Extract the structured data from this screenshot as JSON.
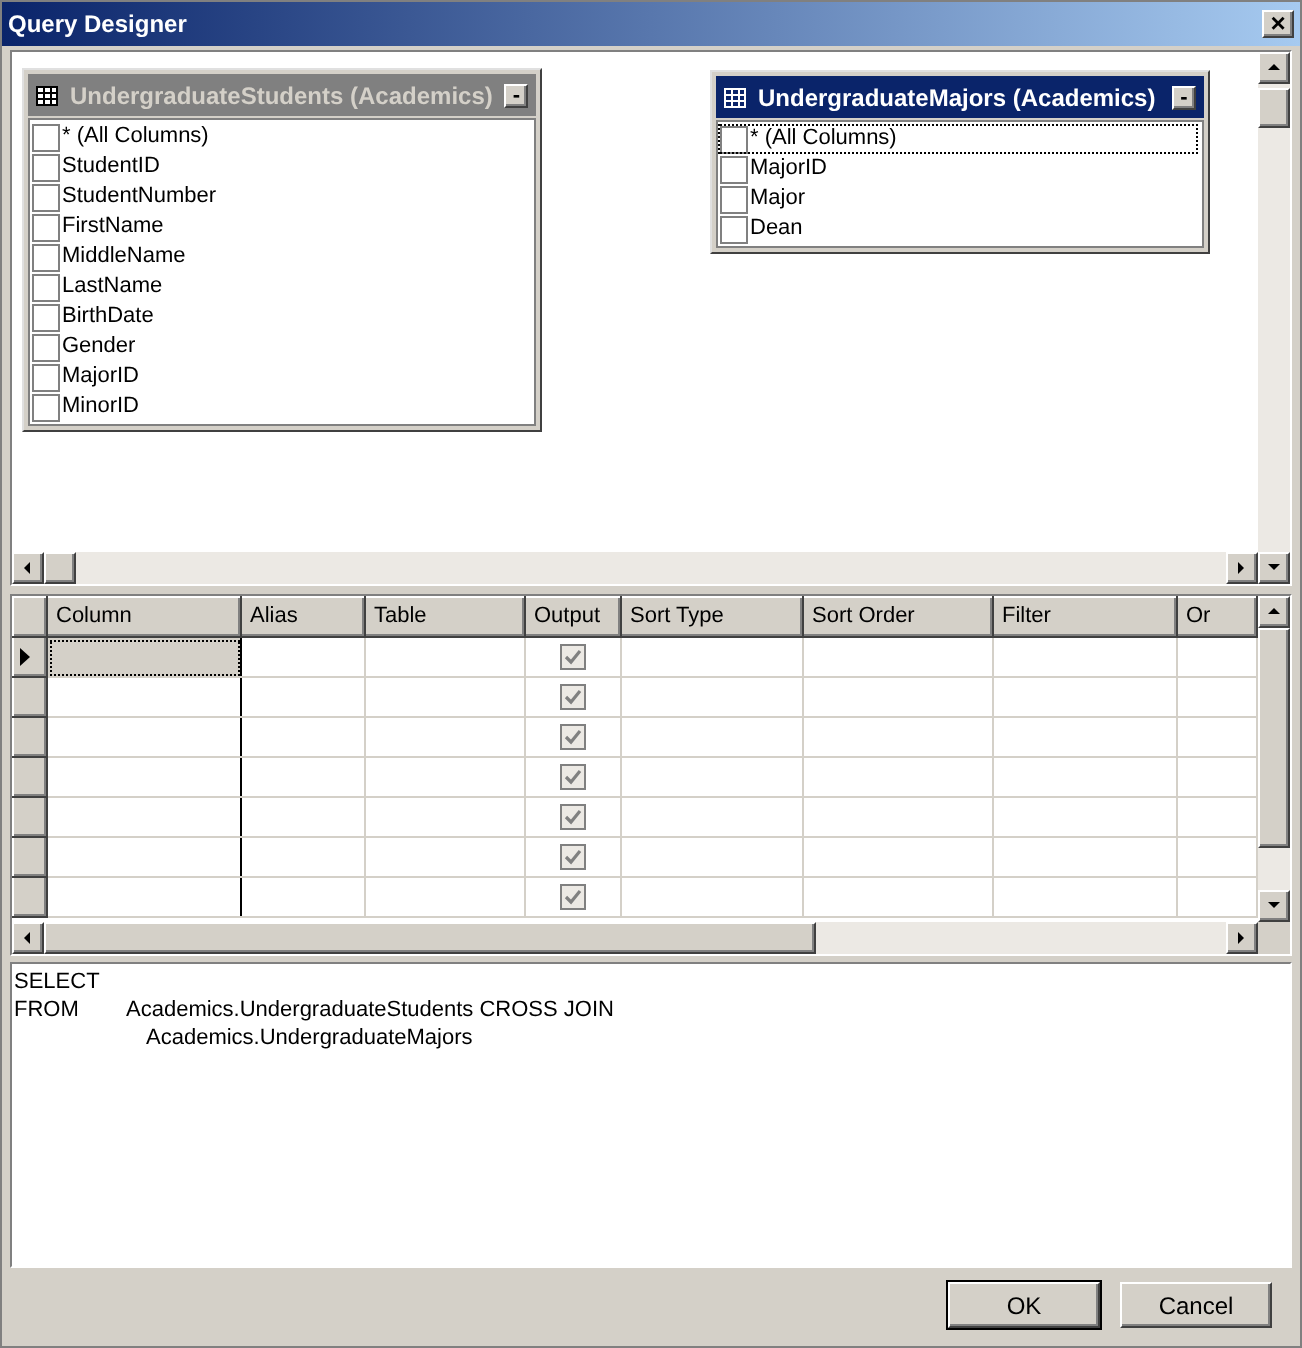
{
  "window": {
    "title": "Query Designer",
    "close": "×"
  },
  "diagram": {
    "tables": [
      {
        "title": "UndergraduateStudents (Academics)",
        "active": false,
        "collapse": "-",
        "columns": [
          {
            "name": "* (All Columns)",
            "checked": false,
            "focused": false
          },
          {
            "name": "StudentID",
            "checked": false,
            "focused": false
          },
          {
            "name": "StudentNumber",
            "checked": false,
            "focused": false
          },
          {
            "name": "FirstName",
            "checked": false,
            "focused": false
          },
          {
            "name": "MiddleName",
            "checked": false,
            "focused": false
          },
          {
            "name": "LastName",
            "checked": false,
            "focused": false
          },
          {
            "name": "BirthDate",
            "checked": false,
            "focused": false
          },
          {
            "name": "Gender",
            "checked": false,
            "focused": false
          },
          {
            "name": "MajorID",
            "checked": false,
            "focused": false
          },
          {
            "name": "MinorID",
            "checked": false,
            "focused": false
          }
        ]
      },
      {
        "title": "UndergraduateMajors (Academics)",
        "active": true,
        "collapse": "-",
        "columns": [
          {
            "name": "* (All Columns)",
            "checked": false,
            "focused": true
          },
          {
            "name": "MajorID",
            "checked": false,
            "focused": false
          },
          {
            "name": "Major",
            "checked": false,
            "focused": false
          },
          {
            "name": "Dean",
            "checked": false,
            "focused": false
          }
        ]
      }
    ]
  },
  "grid": {
    "columns": [
      "Column",
      "Alias",
      "Table",
      "Output",
      "Sort Type",
      "Sort Order",
      "Filter",
      "Or"
    ],
    "rows": [
      {
        "selected": true,
        "output": true
      },
      {
        "selected": false,
        "output": true
      },
      {
        "selected": false,
        "output": true
      },
      {
        "selected": false,
        "output": true
      },
      {
        "selected": false,
        "output": true
      },
      {
        "selected": false,
        "output": true
      },
      {
        "selected": false,
        "output": true
      }
    ]
  },
  "sql": {
    "lines": [
      {
        "kind": "clause",
        "keyword": "SELECT"
      },
      {
        "kind": "clause",
        "keyword": "FROM",
        "text": "Academics.UndergraduateStudents CROSS JOIN"
      },
      {
        "kind": "continuation",
        "text": "Academics.UndergraduateMajors"
      }
    ]
  },
  "buttons": [
    {
      "label": "OK",
      "default": true
    },
    {
      "label": "Cancel",
      "default": false
    }
  ]
}
